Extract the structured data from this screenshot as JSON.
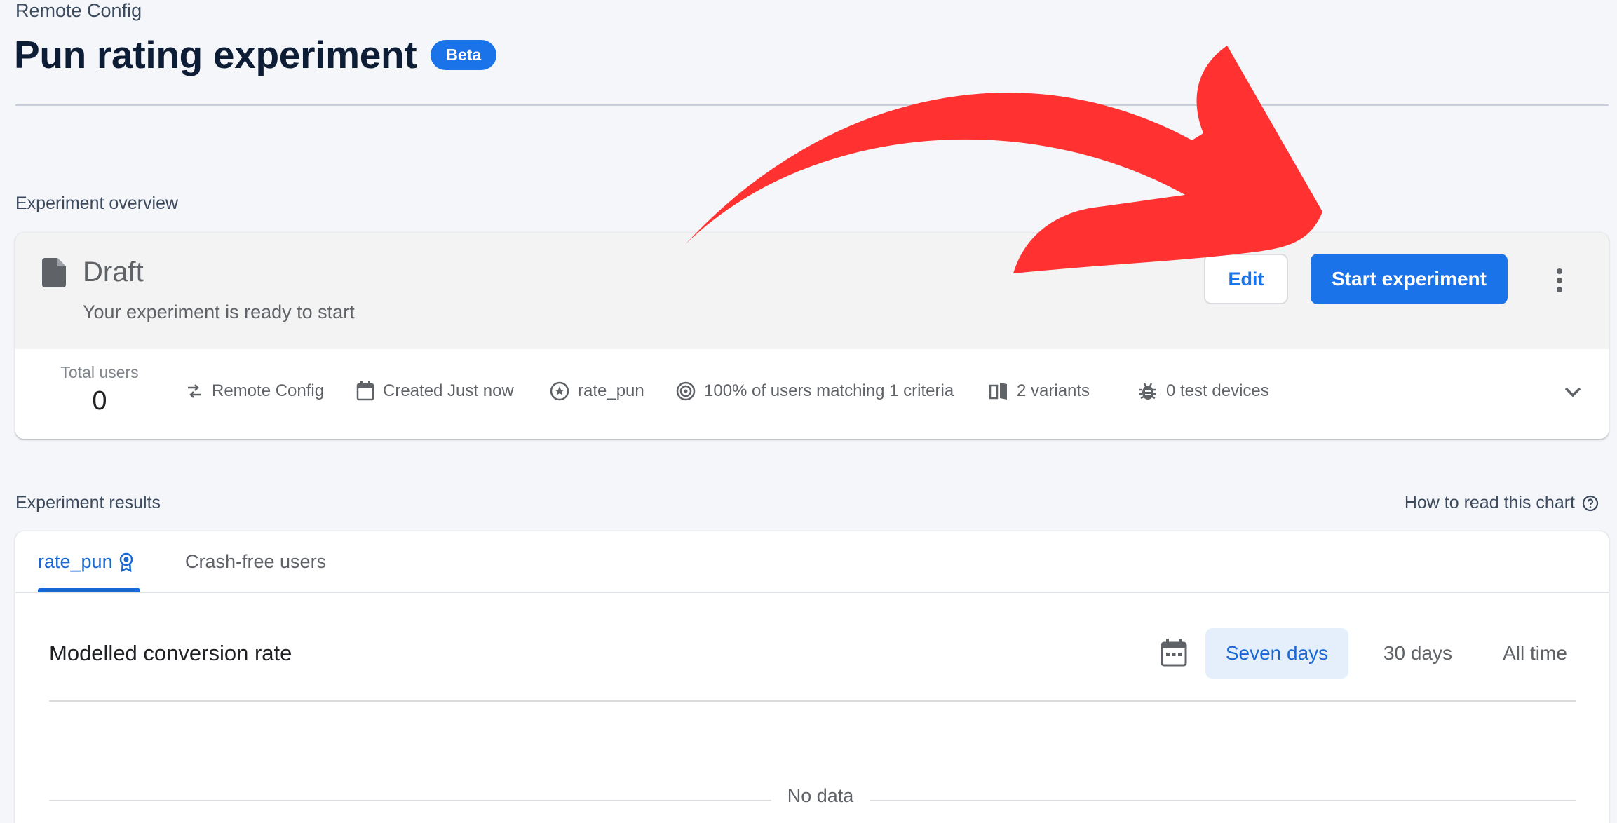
{
  "header": {
    "breadcrumb": "Remote Config",
    "title": "Pun rating experiment",
    "badge": "Beta"
  },
  "overview": {
    "section_label": "Experiment overview",
    "status": "Draft",
    "status_subtitle": "Your experiment is ready to start",
    "edit_label": "Edit",
    "start_label": "Start experiment",
    "total_users_label": "Total users",
    "total_users_value": "0",
    "meta": [
      {
        "icon": "remote-config-icon",
        "text": "Remote Config"
      },
      {
        "icon": "calendar-icon",
        "text": "Created Just now"
      },
      {
        "icon": "goal-star-icon",
        "text": "rate_pun"
      },
      {
        "icon": "target-icon",
        "text": "100% of users matching 1 criteria"
      },
      {
        "icon": "variants-icon",
        "text": "2 variants"
      },
      {
        "icon": "bug-icon",
        "text": "0 test devices"
      }
    ]
  },
  "results": {
    "section_label": "Experiment results",
    "how_to_read": "How to read this chart",
    "tabs": [
      {
        "label": "rate_pun",
        "active": true
      },
      {
        "label": "Crash-free users",
        "active": false
      }
    ],
    "chart_title": "Modelled conversion rate",
    "ranges": [
      "Seven days",
      "30 days",
      "All time"
    ],
    "selected_range": "Seven days",
    "no_data": "No data"
  },
  "colors": {
    "accent": "#1a73e8",
    "annotation_arrow": "#ff3131"
  }
}
